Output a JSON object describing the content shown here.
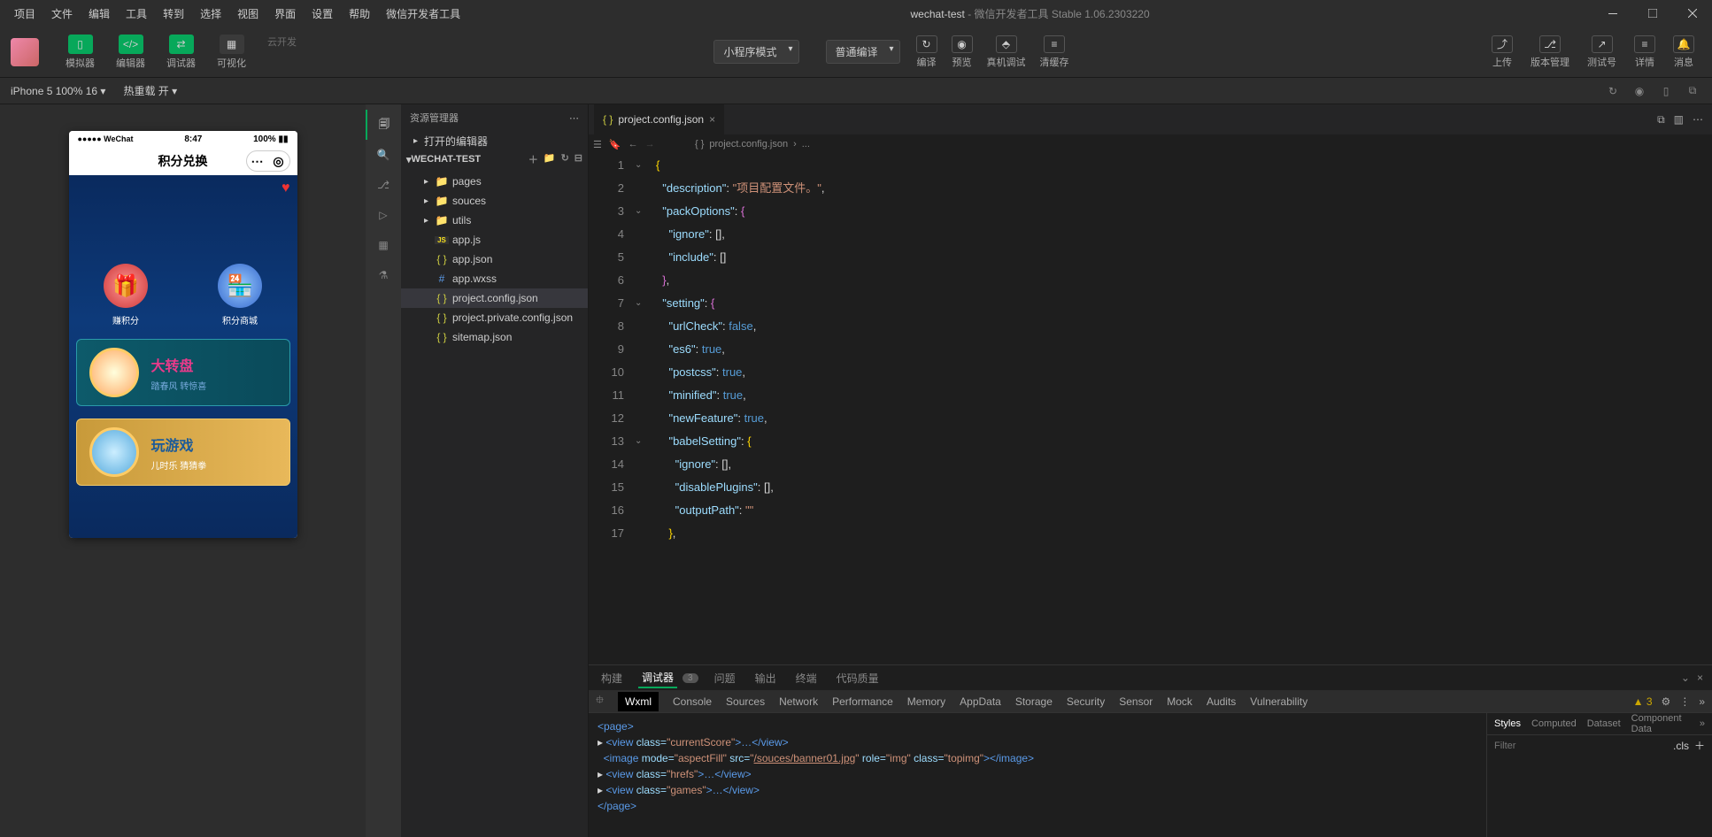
{
  "menu": [
    "项目",
    "文件",
    "编辑",
    "工具",
    "转到",
    "选择",
    "视图",
    "界面",
    "设置",
    "帮助",
    "微信开发者工具"
  ],
  "window_title": {
    "proj": "wechat-test",
    "rest": " - 微信开发者工具 Stable 1.06.2303220"
  },
  "toolbar": {
    "simulator": "模拟器",
    "editor": "编辑器",
    "debugger": "调试器",
    "visualize": "可视化",
    "cloud": "云开发",
    "mode_select": "小程序模式",
    "compile_select": "普通编译",
    "compile": "编译",
    "preview": "预览",
    "remote_debug": "真机调试",
    "clear_cache": "清缓存",
    "upload": "上传",
    "version": "版本管理",
    "test_num": "测试号",
    "details": "详情",
    "message": "消息"
  },
  "devicebar": {
    "device": "iPhone 5 100% 16",
    "hot_reload": "热重载 开"
  },
  "explorer": {
    "title": "资源管理器",
    "open_editors": "打开的编辑器",
    "project": "WECHAT-TEST",
    "tree": [
      {
        "name": "pages",
        "type": "folder",
        "depth": 1,
        "chev": "▸"
      },
      {
        "name": "souces",
        "type": "folder",
        "depth": 1,
        "chev": "▸"
      },
      {
        "name": "utils",
        "type": "folder",
        "depth": 1,
        "chev": "▸"
      },
      {
        "name": "app.js",
        "type": "js",
        "depth": 1
      },
      {
        "name": "app.json",
        "type": "json",
        "depth": 1
      },
      {
        "name": "app.wxss",
        "type": "wxss",
        "depth": 1
      },
      {
        "name": "project.config.json",
        "type": "braces",
        "depth": 1,
        "sel": true
      },
      {
        "name": "project.private.config.json",
        "type": "braces",
        "depth": 1
      },
      {
        "name": "sitemap.json",
        "type": "braces",
        "depth": 1
      }
    ]
  },
  "tab": {
    "name": "project.config.json"
  },
  "breadcrumb": {
    "file": "project.config.json",
    "tail": "..."
  },
  "code_lines": [
    "1",
    "2",
    "3",
    "4",
    "5",
    "6",
    "7",
    "8",
    "9",
    "10",
    "11",
    "12",
    "13",
    "14",
    "15",
    "16",
    "17"
  ],
  "code": {
    "l1": "{",
    "l2_k": "\"description\"",
    "l2_v": "\"项目配置文件。\"",
    "l3_k": "\"packOptions\"",
    "l4_k": "\"ignore\"",
    "l4_v": "[]",
    "l5_k": "\"include\"",
    "l5_v": "[]",
    "l7_k": "\"setting\"",
    "l8_k": "\"urlCheck\"",
    "l8_v": "false",
    "l9_k": "\"es6\"",
    "l9_v": "true",
    "l10_k": "\"postcss\"",
    "l10_v": "true",
    "l11_k": "\"minified\"",
    "l11_v": "true",
    "l12_k": "\"newFeature\"",
    "l12_v": "true",
    "l13_k": "\"babelSetting\"",
    "l14_k": "\"ignore\"",
    "l14_v": "[]",
    "l15_k": "\"disablePlugins\"",
    "l15_v": "[]",
    "l16_k": "\"outputPath\"",
    "l16_v": "\"\""
  },
  "bottom": {
    "tabs": [
      "构建",
      "调试器",
      "问题",
      "输出",
      "终端",
      "代码质量"
    ],
    "badge": "3",
    "devtools": [
      "Wxml",
      "Console",
      "Sources",
      "Network",
      "Performance",
      "Memory",
      "AppData",
      "Storage",
      "Security",
      "Sensor",
      "Mock",
      "Audits",
      "Vulnerability"
    ],
    "warn_count": "3",
    "styles_tabs": [
      "Styles",
      "Computed",
      "Dataset",
      "Component Data"
    ],
    "filter_placeholder": "Filter",
    "cls": ".cls"
  },
  "dom": {
    "l1": "<page>",
    "l2a": "<view",
    "l2b": " class=",
    "l2c": "\"currentScore\"",
    "l2d": ">…</view>",
    "l3a": "<image",
    "l3b": " mode=",
    "l3c": "\"aspectFill\"",
    "l3d": " src=",
    "l3e": "\"",
    "l3f": "/souces/banner01.jpg",
    "l3g": "\"",
    "l3h": " role=",
    "l3i": "\"img\"",
    "l3j": " class=",
    "l3k": "\"topimg\"",
    "l3l": "></image>",
    "l4a": "<view",
    "l4b": " class=",
    "l4c": "\"hrefs\"",
    "l4d": ">…</view>",
    "l5a": "<view",
    "l5b": " class=",
    "l5c": "\"games\"",
    "l5d": ">…</view>",
    "l6": "</page>"
  },
  "phone": {
    "carrier": "●●●●● WeChat",
    "time": "8:47",
    "battery": "100%",
    "title": "积分兑换",
    "icon1": "赚积分",
    "icon2": "积分商城",
    "card1_t": "大转盘",
    "card1_s": "踏春风  转惊喜",
    "card2_t": "玩游戏",
    "card2_s": "儿时乐  猜猜拳"
  }
}
